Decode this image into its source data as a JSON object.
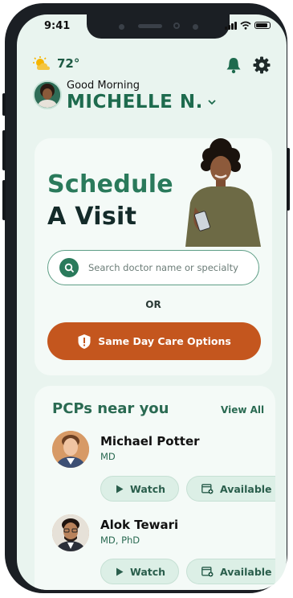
{
  "status_bar": {
    "time": "9:41"
  },
  "weather": {
    "temperature": "72°",
    "icon": "partly-sunny-icon"
  },
  "header": {
    "greeting": "Good Morning",
    "user_name": "MICHELLE N."
  },
  "hero": {
    "title_line1": "Schedule",
    "title_line2": "A Visit",
    "search_placeholder": "Search doctor name or specialty",
    "search_value": "",
    "or_text": "OR",
    "same_day_label": "Same Day Care Options"
  },
  "pcps": {
    "title": "PCPs near you",
    "view_all": "View All",
    "doctors": [
      {
        "name": "Michael Potter",
        "credentials": "MD",
        "watch_label": "Watch",
        "available_label": "Available"
      },
      {
        "name": "Alok Tewari",
        "credentials": "MD, PhD",
        "watch_label": "Watch",
        "available_label": "Available"
      }
    ]
  },
  "colors": {
    "brand_green": "#2a7a5b",
    "accent_orange": "#c4561e",
    "background": "#e9f4ef"
  }
}
